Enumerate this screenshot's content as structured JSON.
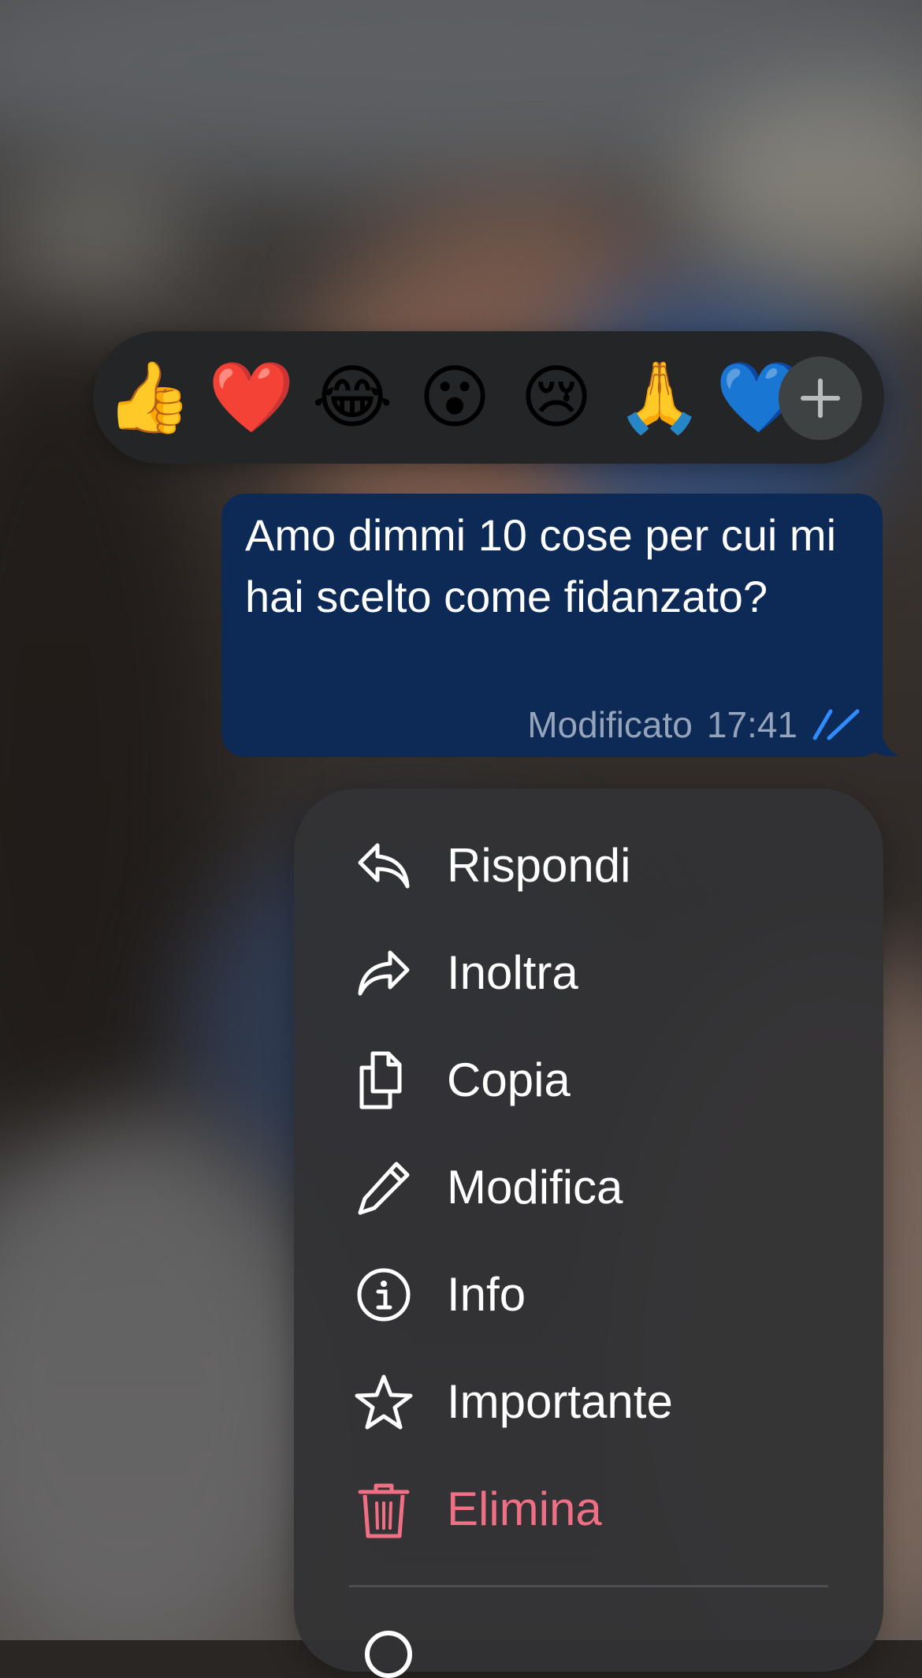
{
  "reactions": {
    "emojis": [
      "👍",
      "❤️",
      "😂",
      "😮",
      "😢",
      "🙏",
      "💙"
    ],
    "more_icon": "plus-icon"
  },
  "message": {
    "text": "Amo dimmi 10 cose per cui mi hai scelto come fidanzato?",
    "edited_label": "Modificato",
    "time": "17:41",
    "status_icon": "double-check-icon",
    "bubble_color": "#0d2a56",
    "status_color": "#2f8cff"
  },
  "menu": {
    "items": [
      {
        "label": "Rispondi",
        "icon": "reply-icon"
      },
      {
        "label": "Inoltra",
        "icon": "forward-icon"
      },
      {
        "label": "Copia",
        "icon": "copy-icon"
      },
      {
        "label": "Modifica",
        "icon": "pencil-icon"
      },
      {
        "label": "Info",
        "icon": "info-icon"
      },
      {
        "label": "Importante",
        "icon": "star-icon"
      },
      {
        "label": "Elimina",
        "icon": "trash-icon"
      }
    ],
    "danger_color": "#ef6f84"
  }
}
